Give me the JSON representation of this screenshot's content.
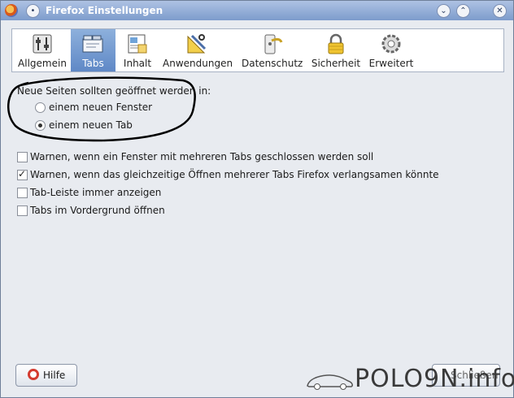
{
  "window": {
    "title": "Firefox Einstellungen"
  },
  "toolbar": {
    "categories": [
      {
        "label": "Allgemein",
        "icon": "switches-icon",
        "selected": false
      },
      {
        "label": "Tabs",
        "icon": "tabs-icon",
        "selected": true
      },
      {
        "label": "Inhalt",
        "icon": "content-icon",
        "selected": false
      },
      {
        "label": "Anwendungen",
        "icon": "applications-icon",
        "selected": false
      },
      {
        "label": "Datenschutz",
        "icon": "privacy-icon",
        "selected": false
      },
      {
        "label": "Sicherheit",
        "icon": "lock-icon",
        "selected": false
      },
      {
        "label": "Erweitert",
        "icon": "gear-icon",
        "selected": false
      }
    ]
  },
  "tabs": {
    "open_new_pages_label": "Neue Seiten sollten geöffnet werden in:",
    "radio_new_window": {
      "label": "einem neuen Fenster",
      "checked": false
    },
    "radio_new_tab": {
      "label": "einem neuen Tab",
      "checked": true
    },
    "warn_on_close": {
      "label": "Warnen, wenn ein Fenster mit mehreren Tabs geschlossen werden soll",
      "checked": false
    },
    "warn_on_open": {
      "label": "Warnen, wenn das gleichzeitige Öffnen mehrerer Tabs Firefox verlangsamen könnte",
      "checked": true
    },
    "always_show_tabbar": {
      "label": "Tab-Leiste immer anzeigen",
      "checked": false
    },
    "open_in_foreground": {
      "label": "Tabs im Vordergrund öffnen",
      "checked": false
    }
  },
  "footer": {
    "help_label": "Hilfe",
    "close_label": "Schließen"
  },
  "watermark": {
    "text": "POLO9N.info"
  },
  "colors": {
    "selected_tab": "#5f88c6",
    "titlebar": "#7d9ccc",
    "annotation": "#000000"
  }
}
